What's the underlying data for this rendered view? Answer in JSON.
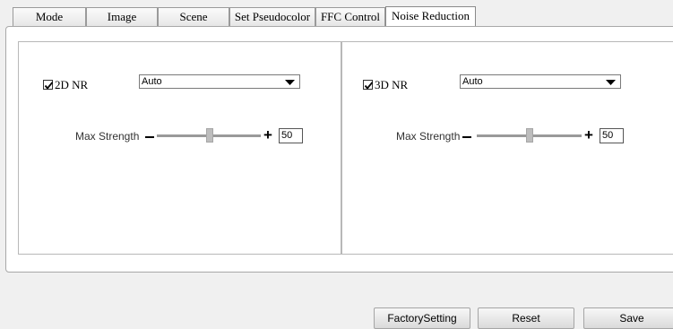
{
  "tabs": [
    {
      "label": "Mode"
    },
    {
      "label": "Image"
    },
    {
      "label": "Scene"
    },
    {
      "label": "Set Pseudocolor"
    },
    {
      "label": "FFC Control"
    },
    {
      "label": "Noise Reduction",
      "active": true
    }
  ],
  "nr2d": {
    "label": "2D NR",
    "checked": true,
    "mode_value": "Auto",
    "strength_label": "Max Strength",
    "strength_value": "50"
  },
  "nr3d": {
    "label": "3D NR",
    "checked": true,
    "mode_value": "Auto",
    "strength_label": "Max Strength",
    "strength_value": "50"
  },
  "buttons": {
    "factory": "FactorySetting",
    "reset": "Reset",
    "save": "Save"
  },
  "icons": {
    "minus": "minus-icon",
    "plus": "plus-icon",
    "dropdown": "dropdown-arrow-icon",
    "check": "checkmark-icon"
  }
}
